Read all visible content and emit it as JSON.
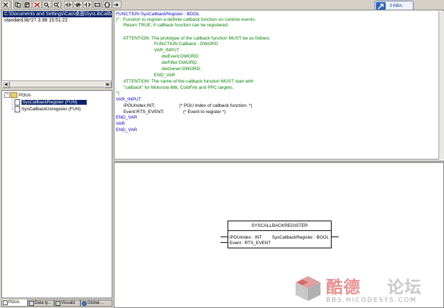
{
  "network": {
    "speed": "0 KB/s"
  },
  "libraries": {
    "rows": [
      "C:\\Documents and Settings\\Cao\\桌面\\SysLibCallback.",
      "standard.lib*27.3.98 15:51:22"
    ]
  },
  "pou_tree": {
    "root": "POUs",
    "items": [
      "SysCallbackRegister (FUN)",
      "SysCallbackUnregister (FUN)"
    ]
  },
  "tabs": [
    "POUs",
    "Data ty...",
    "Visualiz",
    "Global ..."
  ],
  "code": {
    "lines": [
      "FUNCTION SysCallbackRegister : BOOL",
      "(*   Function to register a definite callback function on runtime events.",
      "      Return TRUE, if callback function can be registered.",
      "",
      "      ATTENTION: The prototype of the callback function MUST be as follows:",
      "                              FUNCTION Callback : DWORD",
      "                              VAR_INPUT",
      "                                    dwEvent:DWORD;",
      "                                    dwFilter:DWORD;",
      "                                    dwOwner:DWORD;",
      "                              END_VAR",
      "      ATTENTION: The name of the callback function MUST start with",
      "      \"callback\" for Motorola 68k, ColdFire and PPC targets.",
      "*)",
      "VAR_INPUT",
      "      iPOUIndex:INT;                   (* POU Index of callback function. *)",
      "      Event:RTS_EVENT;               (* Event to register *)",
      "END_VAR",
      "VAR",
      "END_VAR"
    ]
  },
  "function_block": {
    "title": "SYSCALLBACKREGISTER",
    "input1": "iPOUIndex : INT",
    "input2": "Event : RTS_EVENT",
    "output": "SysCallbackRegister : BOOL"
  },
  "watermark": {
    "text1": "酷德",
    "text2": "论坛",
    "url": "BBS.HICODESYS.COM"
  }
}
